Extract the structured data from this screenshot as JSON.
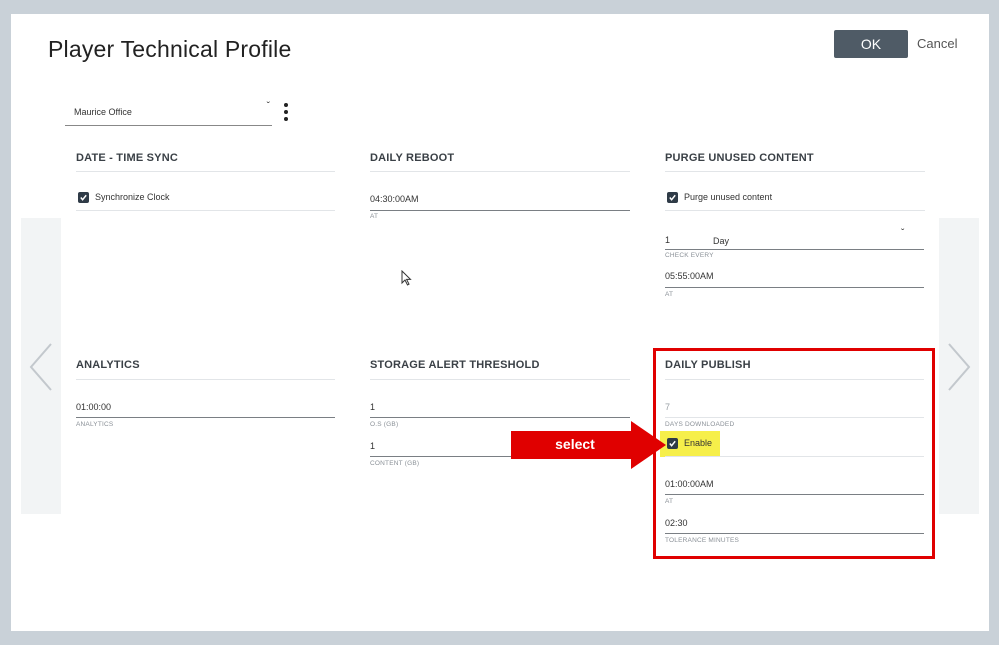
{
  "dialog": {
    "title": "Player Technical Profile",
    "ok_label": "OK",
    "cancel_label": "Cancel",
    "player_select": {
      "value": "Maurice Office"
    }
  },
  "sections": {
    "date_time_sync": {
      "title": "DATE - TIME SYNC",
      "sync_clock_label": "Synchronize Clock",
      "sync_clock_checked": true
    },
    "daily_reboot": {
      "title": "DAILY REBOOT",
      "time": "04:30:00AM",
      "time_caption": "AT"
    },
    "purge_unused": {
      "title": "PURGE UNUSED CONTENT",
      "purge_label": "Purge unused content",
      "purge_checked": true,
      "check_every_value": "1",
      "check_every_unit": "Day",
      "check_every_caption": "CHECK EVERY",
      "time": "05:55:00AM",
      "time_caption": "AT"
    },
    "analytics": {
      "title": "ANALYTICS",
      "value": "01:00:00",
      "caption": "ANALYTICS"
    },
    "storage_alert": {
      "title": "STORAGE ALERT THRESHOLD",
      "os_value": "1",
      "os_caption": "O.S (GB)",
      "content_value": "1",
      "content_caption": "CONTENT (GB)"
    },
    "daily_publish": {
      "title": "DAILY PUBLISH",
      "days_value": "7",
      "days_caption": "DAYS DOWNLOADED",
      "enable_label": "Enable",
      "enable_checked": true,
      "time": "01:00:00AM",
      "time_caption": "AT",
      "tolerance": "02:30",
      "tolerance_caption": "TOLERANCE MINUTES"
    }
  },
  "annotation": {
    "callout_text": "select",
    "arrow_color": "#e00000",
    "box_color": "#e00000",
    "highlight_color": "#f6ef4a"
  },
  "icons": {
    "chevron": "chevron-down-icon",
    "kebab": "kebab-menu-icon",
    "prev": "chevron-left-icon",
    "next": "chevron-right-icon",
    "check": "checkmark-icon",
    "cursor": "mouse-cursor-icon"
  }
}
